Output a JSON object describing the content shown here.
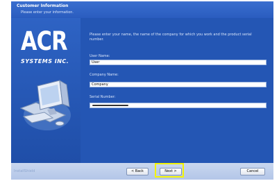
{
  "window": {
    "title": "Customer Information",
    "subtitle": "Please enter your information."
  },
  "logo": {
    "brand": "ACR",
    "subbrand": "SYSTEMS INC."
  },
  "form": {
    "intro": "Please enter your name, the name of the company for which you work and the product serial number.",
    "user_name_label": "User Name:",
    "user_name_value": "User",
    "company_label": "Company Name:",
    "company_value": "Company",
    "serial_label": "Serial Number:"
  },
  "footer": {
    "brand": "InstallShield",
    "back_label": "< Back",
    "next_label": "Next >",
    "cancel_label": "Cancel"
  },
  "colors": {
    "background_blue": "#2456b4",
    "highlight": "#f4f400"
  }
}
